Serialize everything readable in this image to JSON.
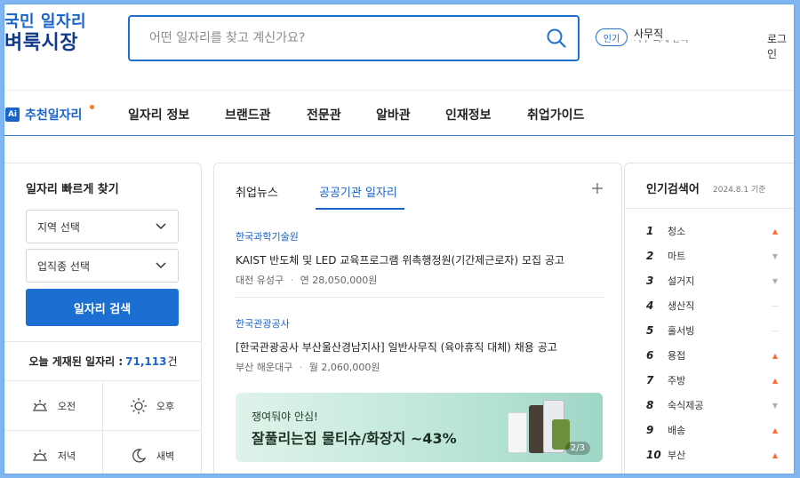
{
  "header": {
    "logo_line1": "국민 일자리",
    "logo_line2": "벼룩시장",
    "search_placeholder": "어떤 일자리를 찾고 계신가요?",
    "popular_label": "인기",
    "popular_word": "사무직",
    "popular_word_next": "사무·회계·관리",
    "login": "로그인"
  },
  "nav": {
    "ai_badge": "Ai",
    "items": [
      "추천일자리",
      "일자리 정보",
      "브랜드관",
      "전문관",
      "알바관",
      "인재정보",
      "취업가이드"
    ]
  },
  "quick_find": {
    "title": "일자리 빠르게 찾기",
    "region_select": "지역 선택",
    "industry_select": "업직종 선택",
    "search_button": "일자리 검색",
    "today_label": "오늘 게재된 일자리 :",
    "today_count": "71,113",
    "today_unit": "건",
    "times": [
      "오전",
      "오후",
      "저녁",
      "새벽"
    ]
  },
  "news": {
    "tabs": [
      "취업뉴스",
      "공공기관 일자리"
    ],
    "active_tab": 1,
    "items": [
      {
        "org": "한국과학기술원",
        "headline": "KAIST 반도체 및 LED 교육프로그램 위촉행정원(기간제근로자) 모집 공고",
        "location": "대전 유성구",
        "pay": "연 28,050,000원"
      },
      {
        "org": "한국관광공사",
        "headline": "[한국관광공사 부산울산경남지사] 일반사무직 (육아휴직 대체) 채용 공고",
        "location": "부산 해운대구",
        "pay": "월 2,060,000원"
      }
    ],
    "banner": {
      "sub": "쟁여둬야 안심!",
      "main": "잘풀리는집 물티슈/화장지 ~43%",
      "pager": "2/3"
    }
  },
  "popular": {
    "title": "인기검색어",
    "date": "2024.8.1 기준",
    "ranks": [
      {
        "rank": "1",
        "word": "청소",
        "trend": "up"
      },
      {
        "rank": "2",
        "word": "마트",
        "trend": "down"
      },
      {
        "rank": "3",
        "word": "설거지",
        "trend": "down"
      },
      {
        "rank": "4",
        "word": "생산직",
        "trend": "same"
      },
      {
        "rank": "5",
        "word": "홀서빙",
        "trend": "same"
      },
      {
        "rank": "6",
        "word": "용접",
        "trend": "up"
      },
      {
        "rank": "7",
        "word": "주방",
        "trend": "up"
      },
      {
        "rank": "8",
        "word": "숙식제공",
        "trend": "down"
      },
      {
        "rank": "9",
        "word": "배송",
        "trend": "up"
      },
      {
        "rank": "10",
        "word": "부산",
        "trend": "up"
      }
    ],
    "trend_symbols": {
      "up": "▲",
      "down": "▼",
      "same": "—"
    }
  },
  "colors": {
    "brand": "#1a63c9",
    "logo_dark": "#123a8a",
    "up": "#ff6a33",
    "frame": "#7fb5f0"
  }
}
